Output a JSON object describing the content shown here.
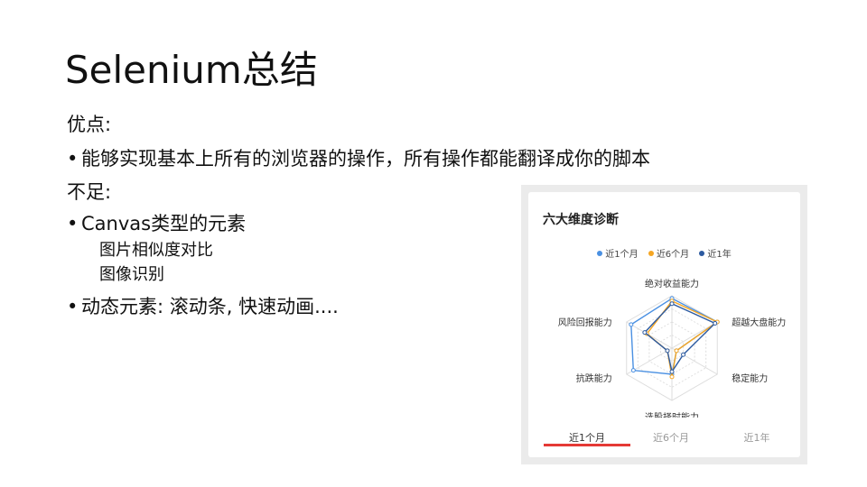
{
  "slide": {
    "title": "Selenium总结",
    "pros_heading": "优点:",
    "pros_bullets": [
      "能够实现基本上所有的浏览器的操作，所有操作都能翻译成你的脚本"
    ],
    "cons_heading": "不足:",
    "cons_bullets": [
      {
        "text": "Canvas类型的元素",
        "sub": [
          "图片相似度对比",
          "图像识别"
        ]
      },
      {
        "text": "动态元素: 滚动条, 快速动画...."
      }
    ],
    "bullet_glyph": "•"
  },
  "panel": {
    "title": "六大维度诊断",
    "tabs": [
      {
        "label": "近1个月",
        "active": true
      },
      {
        "label": "近6个月",
        "active": false
      },
      {
        "label": "近1年",
        "active": false
      }
    ],
    "accent_color": "#e53935"
  },
  "chart_data": {
    "type": "radar",
    "axes": [
      "绝对收益能力",
      "超越大盘能力",
      "稳定能力",
      "选股择时能力",
      "抗跌能力",
      "风险回报能力"
    ],
    "max": 1,
    "series": [
      {
        "name": "近1个月",
        "color": "#4a90e2",
        "values": [
          0.95,
          1.0,
          0.1,
          0.5,
          0.85,
          0.9
        ]
      },
      {
        "name": "近6个月",
        "color": "#f5a623",
        "values": [
          0.9,
          1.0,
          0.1,
          0.55,
          0.1,
          0.55
        ]
      },
      {
        "name": "近1年",
        "color": "#2c5aa0",
        "values": [
          0.85,
          0.95,
          0.25,
          0.45,
          0.1,
          0.6
        ]
      }
    ]
  }
}
